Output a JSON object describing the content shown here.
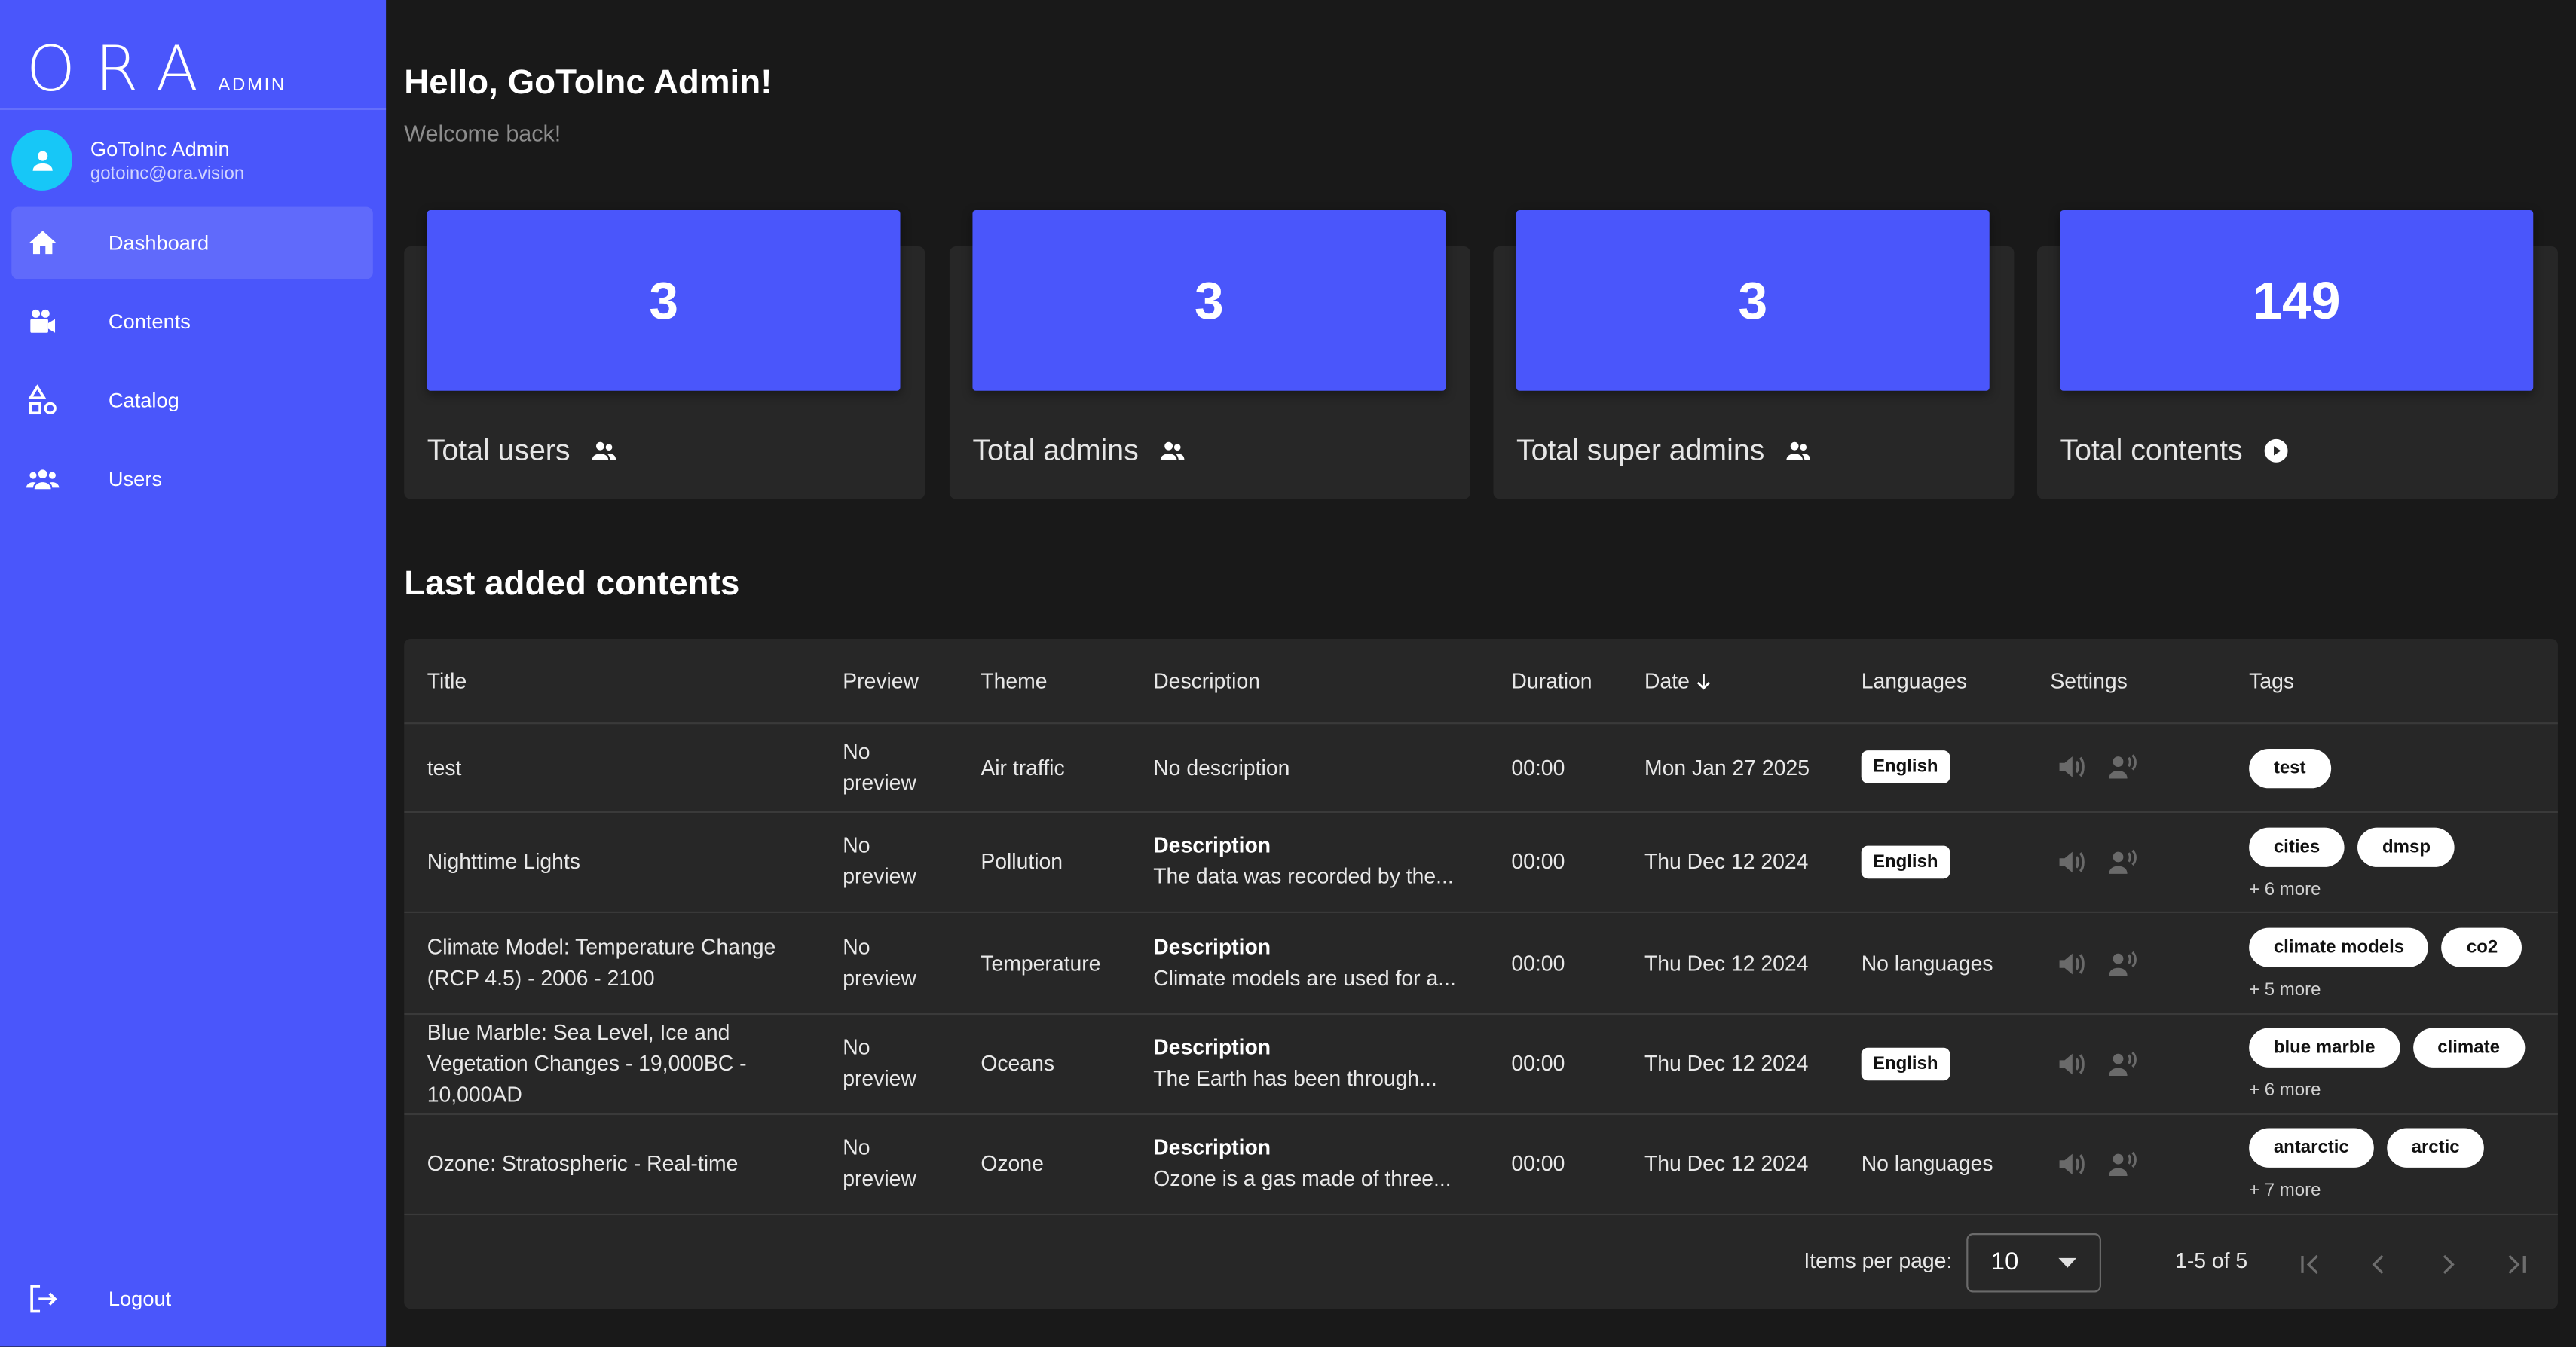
{
  "brand": {
    "logo": "ORA",
    "sub": "ADMIN"
  },
  "profile": {
    "name": "GoToInc Admin",
    "email": "gotoinc@ora.vision"
  },
  "nav": [
    {
      "label": "Dashboard",
      "icon": "home-icon",
      "active": true
    },
    {
      "label": "Contents",
      "icon": "video-camera-icon",
      "active": false
    },
    {
      "label": "Catalog",
      "icon": "shapes-icon",
      "active": false
    },
    {
      "label": "Users",
      "icon": "group-icon",
      "active": false
    }
  ],
  "logout": {
    "label": "Logout",
    "icon": "logout-icon"
  },
  "header": {
    "greeting": "Hello, GoToInc Admin!",
    "subtitle": "Welcome back!"
  },
  "stats": [
    {
      "value": "3",
      "label": "Total users",
      "icon": "people-icon"
    },
    {
      "value": "3",
      "label": "Total admins",
      "icon": "people-icon"
    },
    {
      "value": "3",
      "label": "Total super admins",
      "icon": "people-icon"
    },
    {
      "value": "149",
      "label": "Total contents",
      "icon": "play-circle-icon"
    }
  ],
  "section_title": "Last added contents",
  "table": {
    "columns": [
      "Title",
      "Preview",
      "Theme",
      "Description",
      "Duration",
      "Date",
      "Languages",
      "Settings",
      "Tags"
    ],
    "rows": [
      {
        "title": "test",
        "preview": "No preview",
        "theme": "Air traffic",
        "desc_title": "",
        "description": "No description",
        "duration": "00:00",
        "date": "Mon Jan 27 2025",
        "language": "English",
        "tags": [
          "test"
        ],
        "more": ""
      },
      {
        "title": "Nighttime Lights",
        "preview": "No preview",
        "theme": "Pollution",
        "desc_title": "Description",
        "description": "The data was recorded by the...",
        "duration": "00:00",
        "date": "Thu Dec 12 2024",
        "language": "English",
        "tags": [
          "cities",
          "dmsp"
        ],
        "more": "+ 6 more"
      },
      {
        "title": "Climate Model: Temperature Change (RCP 4.5) - 2006 - 2100",
        "preview": "No preview",
        "theme": "Temperature",
        "desc_title": "Description",
        "description": "Climate models are used for a...",
        "duration": "00:00",
        "date": "Thu Dec 12 2024",
        "language": "No languages",
        "tags": [
          "climate models",
          "co2"
        ],
        "more": "+ 5 more"
      },
      {
        "title": "Blue Marble: Sea Level, Ice and Vegetation Changes - 19,000BC - 10,000AD",
        "preview": "No preview",
        "theme": "Oceans",
        "desc_title": "Description",
        "description": "The Earth has been through...",
        "duration": "00:00",
        "date": "Thu Dec 12 2024",
        "language": "English",
        "tags": [
          "blue marble",
          "climate"
        ],
        "more": "+ 6 more"
      },
      {
        "title": "Ozone: Stratospheric - Real-time",
        "preview": "No preview",
        "theme": "Ozone",
        "desc_title": "Description",
        "description": "Ozone is a gas made of three...",
        "duration": "00:00",
        "date": "Thu Dec 12 2024",
        "language": "No languages",
        "tags": [
          "antarctic",
          "arctic"
        ],
        "more": "+ 7 more"
      }
    ]
  },
  "pagination": {
    "items_per_page_label": "Items per page:",
    "items_per_page": "10",
    "range": "1-5 of 5"
  },
  "colors": {
    "accent": "#4a56fb",
    "background": "#191919",
    "card": "#272727",
    "avatar": "#17c7f7"
  }
}
